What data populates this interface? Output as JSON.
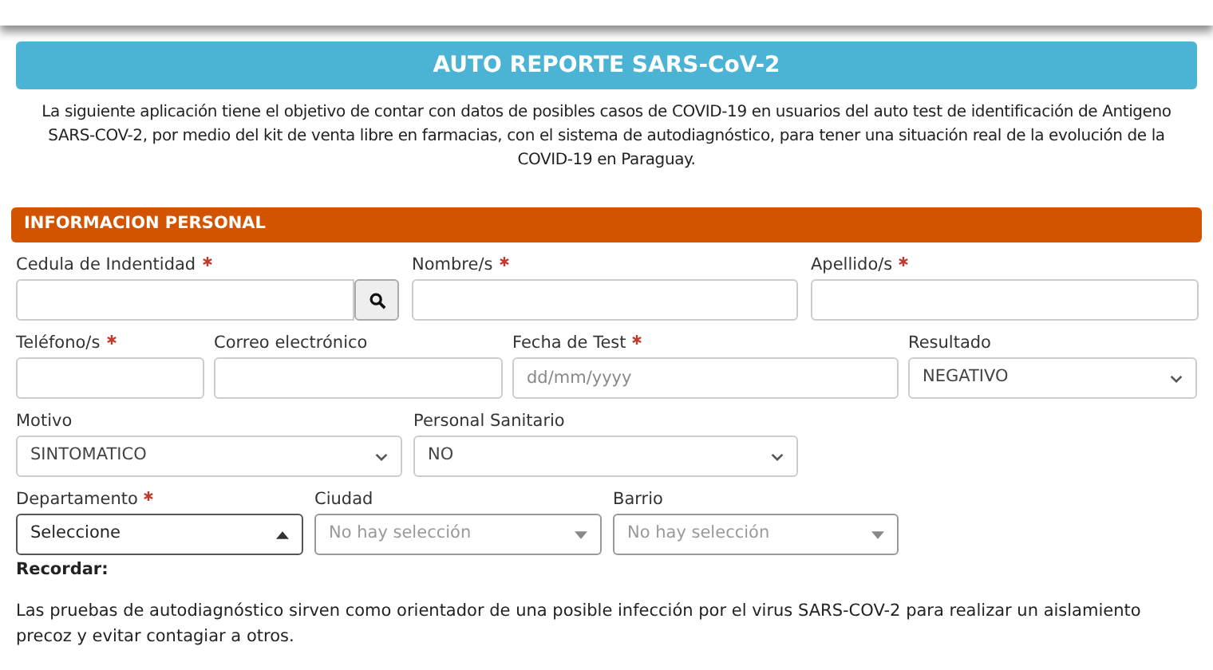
{
  "title": "AUTO REPORTE SARS-CoV-2",
  "intro": "La siguiente aplicación tiene el objetivo de contar con datos de posibles casos de COVID-19 en usuarios del auto test de identificación de Antigeno SARS-COV-2, por medio del kit de venta libre en farmacias, con el sistema de autodiagnóstico, para tener una situación real de la evolución de la COVID-19 en Paraguay.",
  "section": {
    "title": "INFORMACION PERSONAL",
    "rows": [
      [
        {
          "label": "Cedula de Indentidad",
          "required": true,
          "kind": "search"
        },
        {
          "label": "Nombre/s",
          "required": true,
          "kind": "text"
        },
        {
          "label": "Apellido/s",
          "required": true,
          "kind": "text"
        }
      ],
      [
        {
          "label": "Teléfono/s",
          "required": true,
          "kind": "text"
        },
        {
          "label": "Correo electrónico",
          "required": false,
          "kind": "text"
        },
        {
          "label": "Fecha de Test",
          "required": true,
          "kind": "text",
          "placeholder": "dd/mm/yyyy"
        },
        {
          "label": "Resultado",
          "required": false,
          "kind": "select",
          "value": "NEGATIVO"
        }
      ],
      [
        {
          "label": "Motivo",
          "required": false,
          "kind": "select",
          "value": "SINTOMATICO"
        },
        {
          "label": "Personal Sanitario",
          "required": false,
          "kind": "select",
          "value": "NO"
        }
      ],
      [
        {
          "label": "Departamento",
          "required": true,
          "kind": "picker",
          "value": "Seleccione",
          "expanded": true
        },
        {
          "label": "Ciudad",
          "required": false,
          "kind": "picker",
          "placeholder": "No hay selección",
          "expanded": false
        },
        {
          "label": "Barrio",
          "required": false,
          "kind": "picker",
          "placeholder": "No hay selección",
          "expanded": false
        }
      ]
    ]
  },
  "reminder": {
    "title": "Recordar:",
    "text": "Las pruebas de autodiagnóstico sirven como orientador de una posible infección por el virus SARS-COV-2 para realizar un aislamiento precoz y evitar contagiar a otros."
  }
}
